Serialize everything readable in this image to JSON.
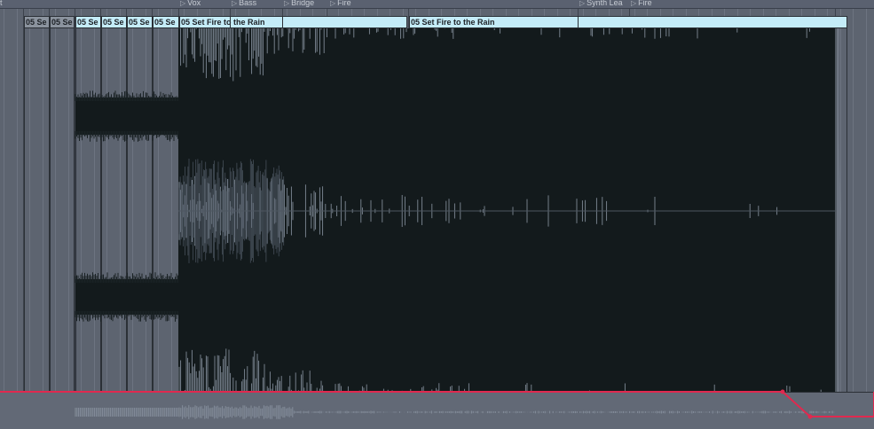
{
  "locators": [
    {
      "label": "t",
      "arrow": false
    },
    {
      "label": "Vox",
      "arrow": true
    },
    {
      "label": "Bass",
      "arrow": true
    },
    {
      "label": "Bridge",
      "arrow": true
    },
    {
      "label": "Fire",
      "arrow": true
    },
    {
      "label": "Synth Lea",
      "arrow": true
    },
    {
      "label": "Fire",
      "arrow": true
    }
  ],
  "clips": [
    {
      "label": "05 Se",
      "style": "dark"
    },
    {
      "label": "05 Se",
      "style": "dark"
    },
    {
      "label": "05 Se",
      "style": "light"
    },
    {
      "label": "05 Se",
      "style": "light"
    },
    {
      "label": "05 Se",
      "style": "light"
    },
    {
      "label": "05 Se",
      "style": "light"
    },
    {
      "label": "05 Set Fire to the Rain",
      "style": "light"
    },
    {
      "label": "05 Set Fire to the Rain",
      "style": "light"
    }
  ],
  "colors": {
    "background": "#5d6470",
    "clip_header": "#c4ecf8",
    "waveform_fill": "#131a1c",
    "waveform_signal": "#8a95a3",
    "automation_line": "#e0294f"
  },
  "icons": {
    "locator_marker": "play-triangle-icon"
  }
}
